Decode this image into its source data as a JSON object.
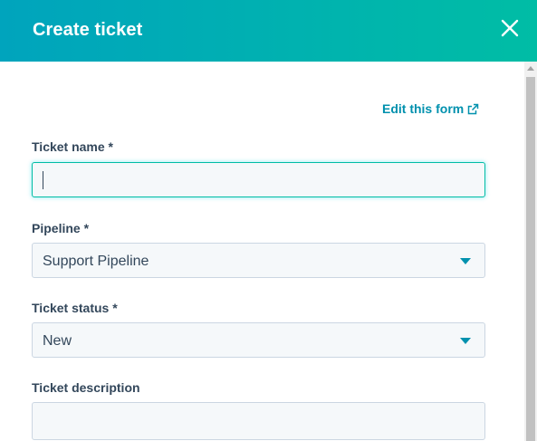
{
  "header": {
    "title": "Create ticket",
    "close_icon": "close-icon"
  },
  "edit_form": {
    "label": "Edit this form",
    "icon": "external-link-icon"
  },
  "fields": {
    "ticket_name": {
      "label": "Ticket name *",
      "value": ""
    },
    "pipeline": {
      "label": "Pipeline *",
      "value": "Support Pipeline"
    },
    "ticket_status": {
      "label": "Ticket status *",
      "value": "New"
    },
    "ticket_description": {
      "label": "Ticket description",
      "value": ""
    }
  },
  "colors": {
    "header_start": "#00a4bd",
    "header_end": "#00bda5",
    "link": "#0091ae",
    "label": "#33475b",
    "input_bg": "#f5f8fa",
    "input_border": "#cbd6e2",
    "focus_border": "#00bda5"
  }
}
